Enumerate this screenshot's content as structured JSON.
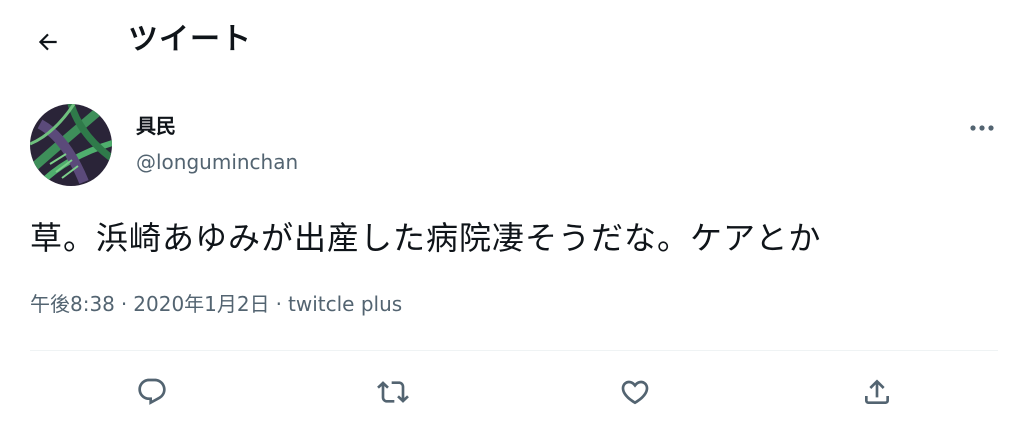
{
  "header": {
    "title": "ツイート",
    "back_icon": "arrow-left-icon"
  },
  "author": {
    "display_name": "具民",
    "handle": "@longuminchan",
    "avatar": "avatar-image"
  },
  "tweet": {
    "text": "草。浜崎あゆみが出産した病院凄そうだな。ケアとか",
    "time": "午後8:38",
    "date": "2020年1月2日",
    "separator": "·",
    "source": "twitcle plus"
  },
  "actions": [
    {
      "icon": "reply-icon"
    },
    {
      "icon": "retweet-icon"
    },
    {
      "icon": "like-icon"
    },
    {
      "icon": "share-icon"
    }
  ],
  "colors": {
    "text": "#0f1419",
    "secondary": "#536471",
    "divider": "#eff3f4"
  }
}
